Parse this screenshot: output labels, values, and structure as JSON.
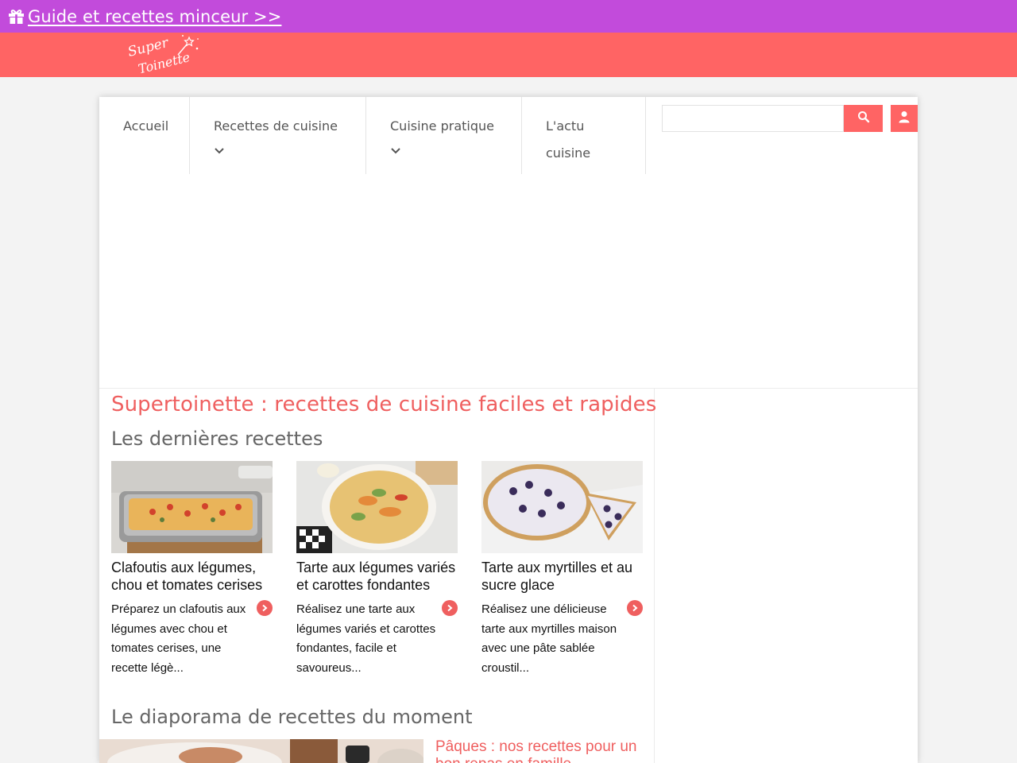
{
  "promo": {
    "text": "Guide et recettes minceur >>",
    "icon": "gift-icon"
  },
  "brand": {
    "logo_line1": "Super",
    "logo_line2": "Toinette"
  },
  "nav": {
    "items": [
      {
        "label": "Accueil"
      },
      {
        "label": "Recettes de cuisine",
        "has_dropdown": true
      },
      {
        "label": "Cuisine pratique",
        "has_dropdown": true
      },
      {
        "label": "L'actu cuisine"
      }
    ]
  },
  "search": {
    "value": "",
    "placeholder": ""
  },
  "main": {
    "site_title": "Supertoinette : recettes de cuisine faciles et rapides",
    "latest_title": "Les dernières recettes",
    "recipes": [
      {
        "title": "Clafoutis aux légumes, chou et tomates cerises",
        "desc": "Préparez un clafoutis aux légumes avec chou et tomates cerises, une recette légè..."
      },
      {
        "title": "Tarte aux légumes variés et carottes fondantes",
        "desc": "Réalisez une tarte aux légumes variés et carottes fondantes, facile et savoureus..."
      },
      {
        "title": "Tarte aux myrtilles et au sucre glace",
        "desc": "Réalisez une délicieuse tarte aux myrtilles maison avec une pâte sablée croustil..."
      }
    ],
    "slideshow_title": "Le diaporama de recettes du moment",
    "slideshow_item": "Pâques : nos recettes pour un bon repas en famille"
  },
  "colors": {
    "promo": "#c24bdb",
    "brand": "#ff6464",
    "accent": "#ef5f5f"
  }
}
